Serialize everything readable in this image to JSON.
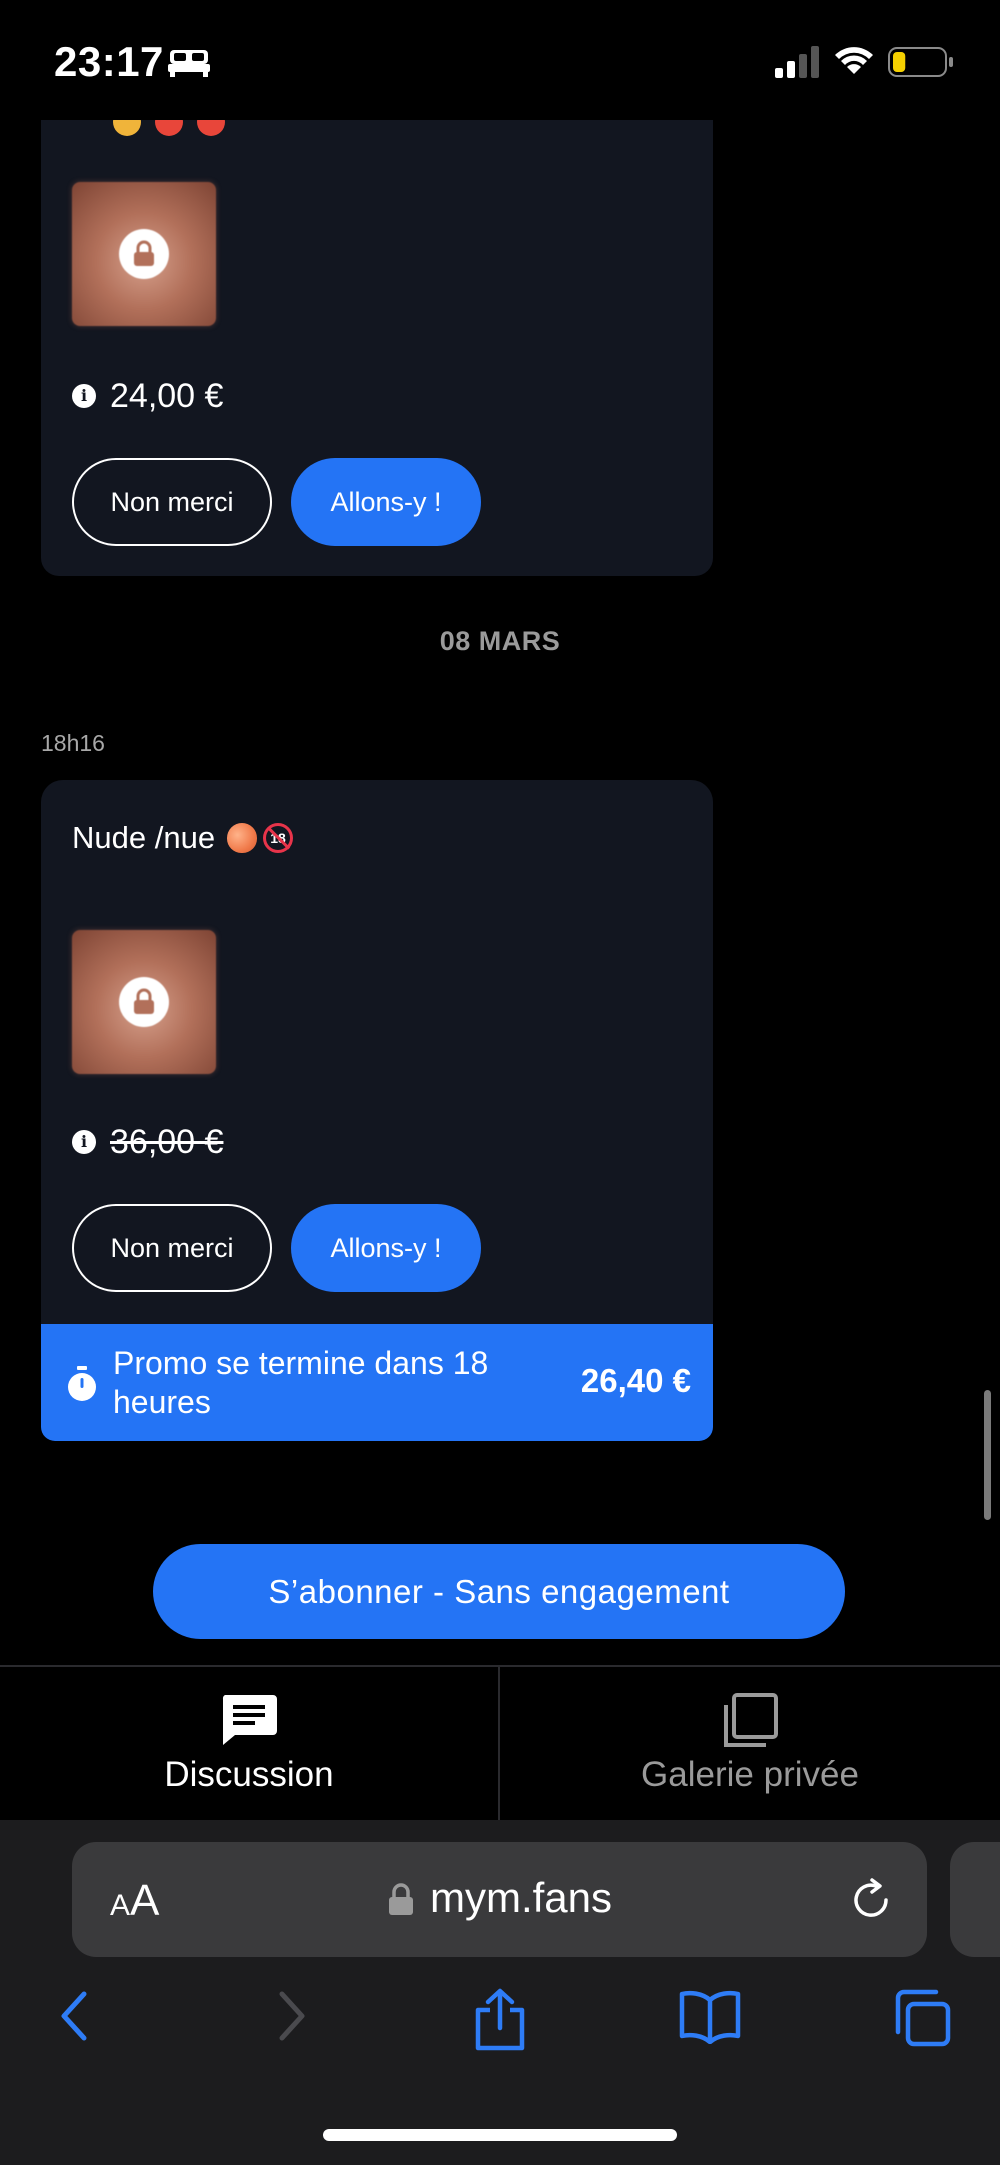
{
  "status": {
    "time": "23:17",
    "icons": [
      "bed-icon",
      "signal-icon",
      "wifi-icon",
      "battery-icon"
    ],
    "battery_level": 0.25,
    "battery_color": "#f5d000"
  },
  "messages": [
    {
      "price": "24,00 €",
      "decline_label": "Non merci",
      "accept_label": "Allons-y !"
    },
    {
      "time": "18h16",
      "title": "Nude /nue",
      "price": "36,00 €",
      "decline_label": "Non merci",
      "accept_label": "Allons-y !",
      "promo": {
        "text": "Promo se termine dans 18 heures",
        "price": "26,40 €"
      }
    }
  ],
  "date_separator": "08 MARS",
  "subscribe_label": "S’abonner - Sans engagement",
  "tabs": [
    {
      "label": "Discussion",
      "icon": "chat-icon",
      "active": true
    },
    {
      "label": "Galerie privée",
      "icon": "gallery-icon",
      "active": false
    }
  ],
  "browser": {
    "aa_small": "A",
    "aa_big": "A",
    "url": "mym.fans",
    "toolbar_icons": [
      "back-icon",
      "forward-icon",
      "share-icon",
      "bookmarks-icon",
      "tabs-icon"
    ]
  },
  "colors": {
    "accent": "#2474f5",
    "card": "#121620",
    "background": "#000000"
  }
}
